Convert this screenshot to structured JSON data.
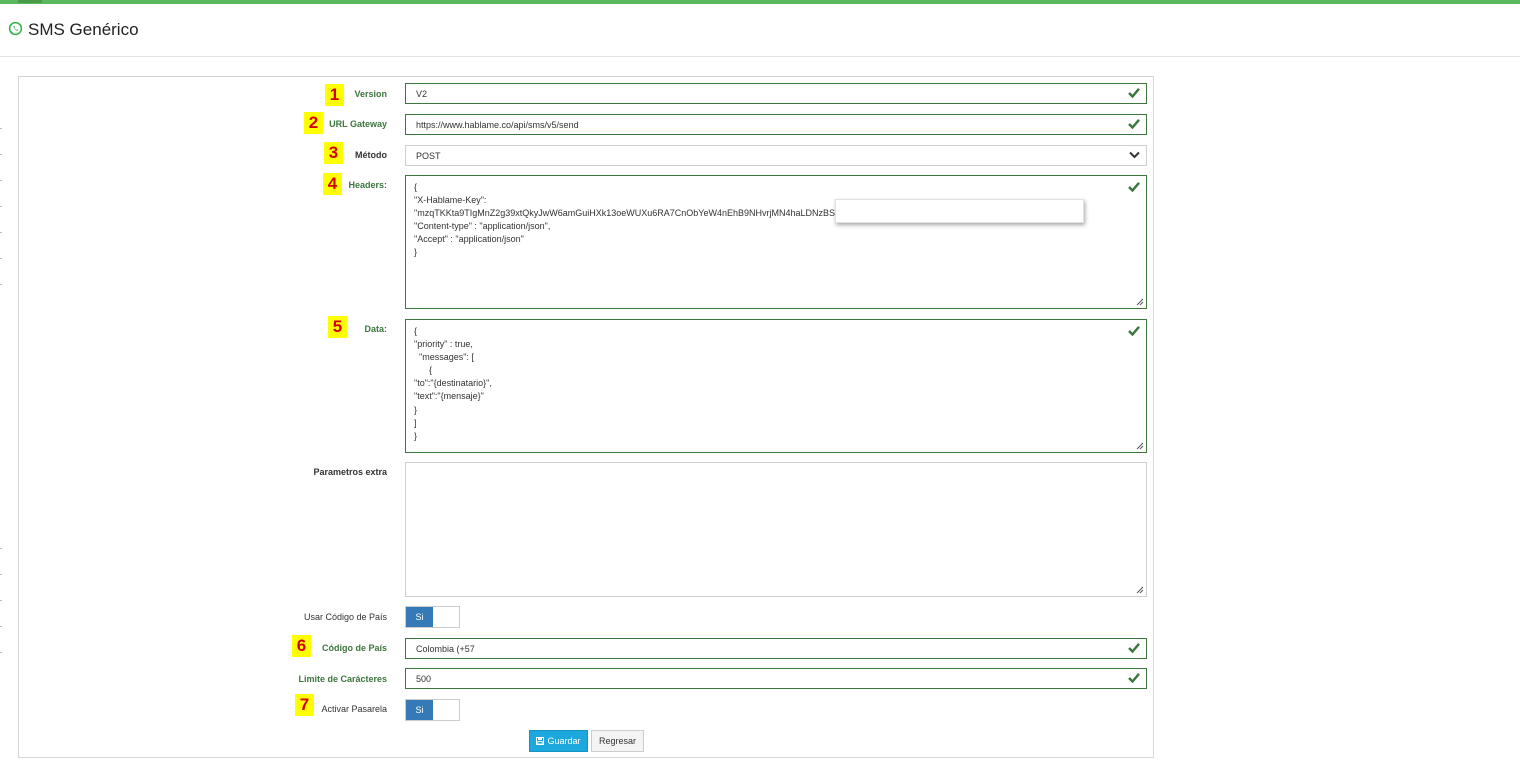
{
  "page": {
    "title": "SMS Genérico"
  },
  "form": {
    "version": {
      "label": "Version",
      "value": "V2",
      "badge": "1"
    },
    "url_gateway": {
      "label": "URL Gateway",
      "value": "https://www.hablame.co/api/sms/v5/send",
      "badge": "2"
    },
    "metodo": {
      "label": "Método",
      "value": "POST",
      "badge": "3"
    },
    "headers": {
      "label": "Headers:",
      "badge": "4",
      "lines": [
        "{",
        "\"X-Hablame-Key\":",
        "\"mzqTKKta9TIgMnZ2g39xtQkyJwW6amGuiHXk13oeWUXu6RA7CnObYeW4nEhB9NHvrjMN4haLDNzBSrQ",
        "\"Content-type\" : \"application/json\",",
        "\"Accept\" : \"application/json\"",
        "}"
      ]
    },
    "data": {
      "label": "Data:",
      "badge": "5",
      "lines": [
        "{",
        "\"priority\" : true,",
        "  \"messages\": [",
        "      {",
        "\"to\":\"{destinatario}\",",
        "\"text\":\"{mensaje}\"",
        "}",
        "]",
        "}"
      ]
    },
    "parametros_extra": {
      "label": "Parametros extra",
      "value": ""
    },
    "usar_codigo_pais": {
      "label": "Usar Código de País",
      "toggle": "Si"
    },
    "codigo_pais": {
      "label": "Código de País",
      "value": "Colombia (+57",
      "badge": "6"
    },
    "limite_caracteres": {
      "label": "Limite de Carácteres",
      "value": "500"
    },
    "activar_pasarela": {
      "label": "Activar Pasarela",
      "toggle": "Si",
      "badge": "7"
    }
  },
  "buttons": {
    "save": "Guardar",
    "back": "Regresar"
  },
  "colors": {
    "valid": "#3c763d",
    "topbar": "#5cb85c",
    "primary": "#1ca8dd",
    "toggle_on": "#337ab7",
    "badge_bg": "#ffff00",
    "badge_text": "#d40000"
  },
  "icons": {
    "title": "whatsapp-icon",
    "valid": "check-icon",
    "select": "chevron-down-icon",
    "save": "floppy-icon",
    "resize": "resize-grip-icon"
  }
}
